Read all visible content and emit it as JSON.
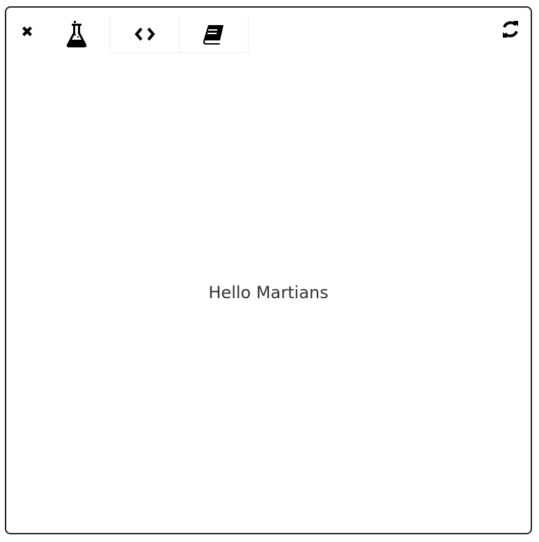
{
  "toolbar": {
    "close_icon": "close-icon",
    "refresh_icon": "refresh-icon",
    "tabs": [
      {
        "icon": "flask-icon",
        "active": true
      },
      {
        "icon": "code-icon",
        "active": false
      },
      {
        "icon": "book-icon",
        "active": false
      }
    ]
  },
  "main": {
    "message": "Hello Martians"
  },
  "colors": {
    "border": "#222222",
    "text": "#333333",
    "icon": "#000000",
    "tab_divider": "#eeeeee"
  }
}
